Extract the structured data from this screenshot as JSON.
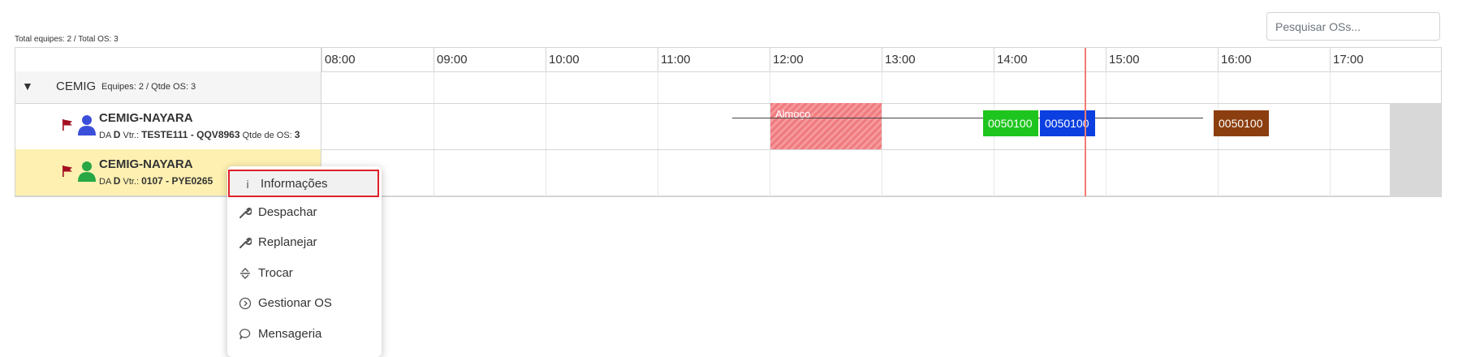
{
  "search": {
    "placeholder": "Pesquisar OSs..."
  },
  "summary": "Total equipes: 2 / Total OS: 3",
  "hours": [
    "08:00",
    "09:00",
    "10:00",
    "11:00",
    "12:00",
    "13:00",
    "14:00",
    "15:00",
    "16:00",
    "17:00"
  ],
  "group": {
    "name": "CEMIG",
    "meta": "Equipes: 2 / Qtde OS: 3"
  },
  "teams": [
    {
      "name": "CEMIG-NAYARA",
      "prefix": "DA",
      "code": "D",
      "vtr_label": "Vtr.:",
      "vtr": "TESTE111 - QQV8963",
      "os_label": "Qtde de OS:",
      "os_count": "3",
      "person_color": "#3a4fd9"
    },
    {
      "name": "CEMIG-NAYARA",
      "prefix": "DA",
      "code": "D",
      "vtr_label": "Vtr.:",
      "vtr": "0107 - PYE0265",
      "person_color": "#28a745"
    }
  ],
  "lunch_label": "Almoço",
  "orders": [
    {
      "label": "0050100",
      "color": "#1ec51e"
    },
    {
      "label": "0050100",
      "color": "#0b3fe0"
    },
    {
      "label": "0050100",
      "color": "#8b3e0f"
    }
  ],
  "context_menu": {
    "items": [
      {
        "label": "Informações",
        "icon": "info-icon"
      },
      {
        "label": "Despachar",
        "icon": "wrench-icon"
      },
      {
        "label": "Replanejar",
        "icon": "wrench-icon"
      },
      {
        "label": "Trocar",
        "icon": "swap-icon"
      },
      {
        "label": "Gestionar OS",
        "icon": "chevron-circle-icon"
      },
      {
        "label": "Mensageria",
        "icon": "chat-icon"
      }
    ]
  },
  "colors": {
    "selected_row": "#fdf0b1",
    "now_line": "#f07b73",
    "flag": "#a30d1f",
    "highlight_border": "#e0202a"
  }
}
